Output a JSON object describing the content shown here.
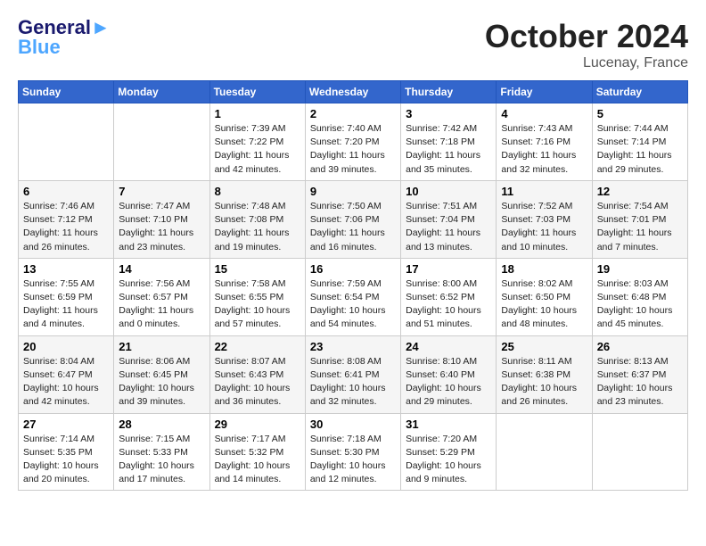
{
  "header": {
    "logo_general": "General",
    "logo_blue": "Blue",
    "month": "October 2024",
    "location": "Lucenay, France"
  },
  "weekdays": [
    "Sunday",
    "Monday",
    "Tuesday",
    "Wednesday",
    "Thursday",
    "Friday",
    "Saturday"
  ],
  "weeks": [
    [
      {
        "day": "",
        "info": ""
      },
      {
        "day": "",
        "info": ""
      },
      {
        "day": "1",
        "info": "Sunrise: 7:39 AM\nSunset: 7:22 PM\nDaylight: 11 hours and 42 minutes."
      },
      {
        "day": "2",
        "info": "Sunrise: 7:40 AM\nSunset: 7:20 PM\nDaylight: 11 hours and 39 minutes."
      },
      {
        "day": "3",
        "info": "Sunrise: 7:42 AM\nSunset: 7:18 PM\nDaylight: 11 hours and 35 minutes."
      },
      {
        "day": "4",
        "info": "Sunrise: 7:43 AM\nSunset: 7:16 PM\nDaylight: 11 hours and 32 minutes."
      },
      {
        "day": "5",
        "info": "Sunrise: 7:44 AM\nSunset: 7:14 PM\nDaylight: 11 hours and 29 minutes."
      }
    ],
    [
      {
        "day": "6",
        "info": "Sunrise: 7:46 AM\nSunset: 7:12 PM\nDaylight: 11 hours and 26 minutes."
      },
      {
        "day": "7",
        "info": "Sunrise: 7:47 AM\nSunset: 7:10 PM\nDaylight: 11 hours and 23 minutes."
      },
      {
        "day": "8",
        "info": "Sunrise: 7:48 AM\nSunset: 7:08 PM\nDaylight: 11 hours and 19 minutes."
      },
      {
        "day": "9",
        "info": "Sunrise: 7:50 AM\nSunset: 7:06 PM\nDaylight: 11 hours and 16 minutes."
      },
      {
        "day": "10",
        "info": "Sunrise: 7:51 AM\nSunset: 7:04 PM\nDaylight: 11 hours and 13 minutes."
      },
      {
        "day": "11",
        "info": "Sunrise: 7:52 AM\nSunset: 7:03 PM\nDaylight: 11 hours and 10 minutes."
      },
      {
        "day": "12",
        "info": "Sunrise: 7:54 AM\nSunset: 7:01 PM\nDaylight: 11 hours and 7 minutes."
      }
    ],
    [
      {
        "day": "13",
        "info": "Sunrise: 7:55 AM\nSunset: 6:59 PM\nDaylight: 11 hours and 4 minutes."
      },
      {
        "day": "14",
        "info": "Sunrise: 7:56 AM\nSunset: 6:57 PM\nDaylight: 11 hours and 0 minutes."
      },
      {
        "day": "15",
        "info": "Sunrise: 7:58 AM\nSunset: 6:55 PM\nDaylight: 10 hours and 57 minutes."
      },
      {
        "day": "16",
        "info": "Sunrise: 7:59 AM\nSunset: 6:54 PM\nDaylight: 10 hours and 54 minutes."
      },
      {
        "day": "17",
        "info": "Sunrise: 8:00 AM\nSunset: 6:52 PM\nDaylight: 10 hours and 51 minutes."
      },
      {
        "day": "18",
        "info": "Sunrise: 8:02 AM\nSunset: 6:50 PM\nDaylight: 10 hours and 48 minutes."
      },
      {
        "day": "19",
        "info": "Sunrise: 8:03 AM\nSunset: 6:48 PM\nDaylight: 10 hours and 45 minutes."
      }
    ],
    [
      {
        "day": "20",
        "info": "Sunrise: 8:04 AM\nSunset: 6:47 PM\nDaylight: 10 hours and 42 minutes."
      },
      {
        "day": "21",
        "info": "Sunrise: 8:06 AM\nSunset: 6:45 PM\nDaylight: 10 hours and 39 minutes."
      },
      {
        "day": "22",
        "info": "Sunrise: 8:07 AM\nSunset: 6:43 PM\nDaylight: 10 hours and 36 minutes."
      },
      {
        "day": "23",
        "info": "Sunrise: 8:08 AM\nSunset: 6:41 PM\nDaylight: 10 hours and 32 minutes."
      },
      {
        "day": "24",
        "info": "Sunrise: 8:10 AM\nSunset: 6:40 PM\nDaylight: 10 hours and 29 minutes."
      },
      {
        "day": "25",
        "info": "Sunrise: 8:11 AM\nSunset: 6:38 PM\nDaylight: 10 hours and 26 minutes."
      },
      {
        "day": "26",
        "info": "Sunrise: 8:13 AM\nSunset: 6:37 PM\nDaylight: 10 hours and 23 minutes."
      }
    ],
    [
      {
        "day": "27",
        "info": "Sunrise: 7:14 AM\nSunset: 5:35 PM\nDaylight: 10 hours and 20 minutes."
      },
      {
        "day": "28",
        "info": "Sunrise: 7:15 AM\nSunset: 5:33 PM\nDaylight: 10 hours and 17 minutes."
      },
      {
        "day": "29",
        "info": "Sunrise: 7:17 AM\nSunset: 5:32 PM\nDaylight: 10 hours and 14 minutes."
      },
      {
        "day": "30",
        "info": "Sunrise: 7:18 AM\nSunset: 5:30 PM\nDaylight: 10 hours and 12 minutes."
      },
      {
        "day": "31",
        "info": "Sunrise: 7:20 AM\nSunset: 5:29 PM\nDaylight: 10 hours and 9 minutes."
      },
      {
        "day": "",
        "info": ""
      },
      {
        "day": "",
        "info": ""
      }
    ]
  ]
}
